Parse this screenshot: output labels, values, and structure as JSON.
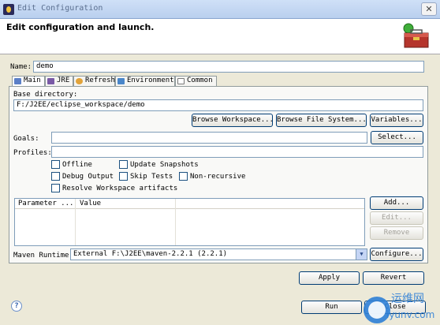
{
  "window": {
    "title": "Edit Configuration"
  },
  "header": {
    "heading": "Edit configuration and launch."
  },
  "name": {
    "label": "Name:",
    "value": "demo"
  },
  "tabs": [
    {
      "label": "Main",
      "icon": "maven-main-icon",
      "active": true
    },
    {
      "label": "JRE",
      "icon": "jre-icon"
    },
    {
      "label": "Refresh",
      "icon": "refresh-icon"
    },
    {
      "label": "Environment",
      "icon": "environment-icon"
    },
    {
      "label": "Common",
      "icon": "common-icon"
    }
  ],
  "main": {
    "base_directory_label": "Base directory:",
    "base_directory_value": "F:/J2EE/eclipse_workspace/demo",
    "browse_workspace": "Browse Workspace...",
    "browse_file_system": "Browse File System...",
    "variables": "Variables...",
    "goals_label": "Goals:",
    "goals_value": "",
    "select": "Select...",
    "profiles_label": "Profiles:",
    "profiles_value": "",
    "checkboxes": {
      "offline": {
        "label": "Offline",
        "checked": false
      },
      "update_snapshots": {
        "label": "Update Snapshots",
        "checked": false
      },
      "debug_output": {
        "label": "Debug Output",
        "checked": false
      },
      "skip_tests": {
        "label": "Skip Tests",
        "checked": false
      },
      "non_recursive": {
        "label": "Non-recursive",
        "checked": false
      },
      "resolve_workspace": {
        "label": "Resolve Workspace artifacts",
        "checked": false
      }
    },
    "params_table": {
      "columns": [
        "Parameter ...",
        "Value"
      ],
      "rows": []
    },
    "add": "Add...",
    "edit": "Edit...",
    "remove": "Remove",
    "maven_runtime_label": "Maven Runtime:",
    "maven_runtime_value": "External F:\\J2EE\\maven-2.2.1 (2.2.1)",
    "configure": "Configure..."
  },
  "actions": {
    "apply": "Apply",
    "revert": "Revert",
    "run": "Run",
    "close": "Close"
  },
  "watermark": {
    "text": "iyunv.com",
    "text_cn": "运维网"
  },
  "colors": {
    "accent": "#003c74",
    "window_bg": "#ece9d8"
  }
}
